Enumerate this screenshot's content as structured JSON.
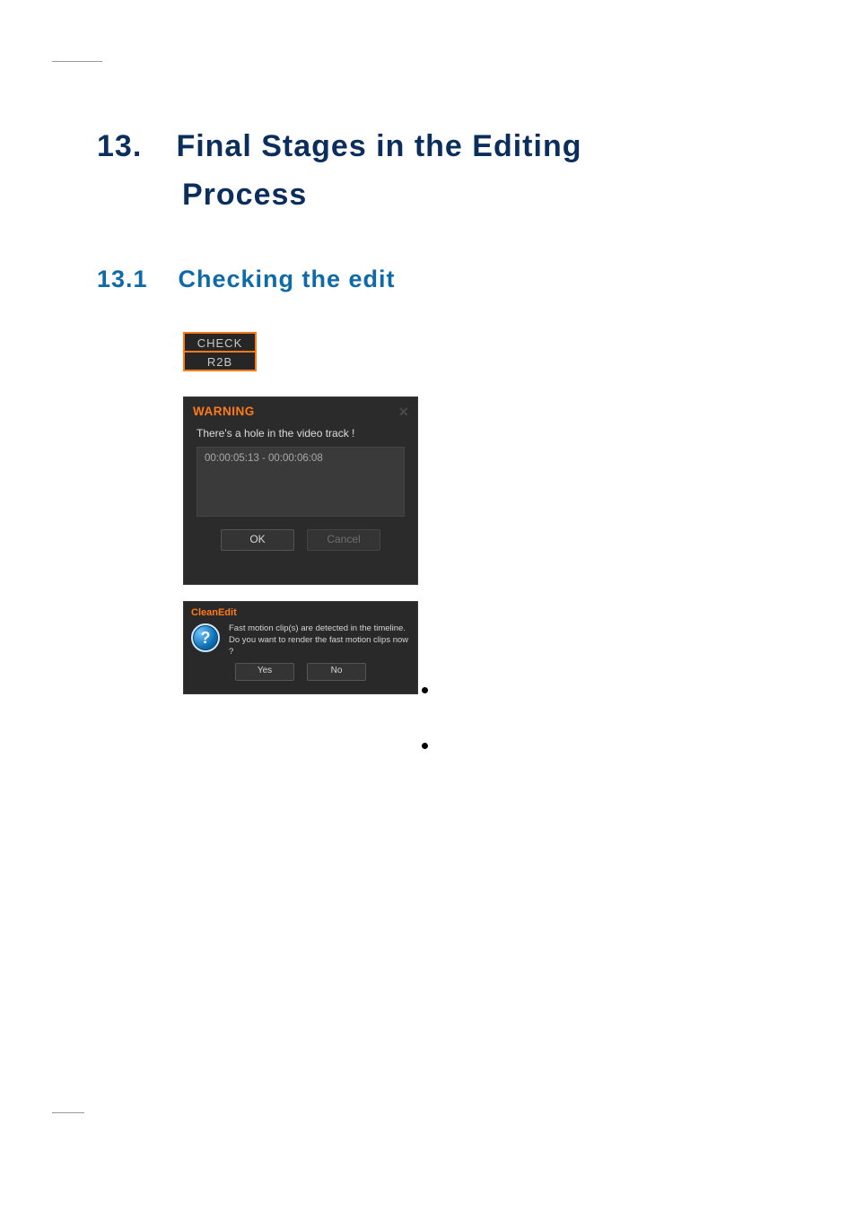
{
  "heading": {
    "number": "13.",
    "title_line1": "Final  Stages  in  the  Editing",
    "title_line2": "Process"
  },
  "subheading": {
    "number": "13.1",
    "title": "Checking  the  edit"
  },
  "check_button": {
    "top": "CHECK",
    "bottom": "R2B"
  },
  "warning_dialog": {
    "title": "WARNING",
    "close_glyph": "×",
    "message": "There's a hole in the video track !",
    "list_item": "00:00:05:13 - 00:00:06:08",
    "ok": "OK",
    "cancel": "Cancel"
  },
  "cleanedit_dialog": {
    "title": "CleanEdit",
    "q": "?",
    "line1": "Fast motion clip(s) are detected in the timeline.",
    "line2": "Do you want to render the fast motion clips now ?",
    "yes": "Yes",
    "no": "No"
  }
}
